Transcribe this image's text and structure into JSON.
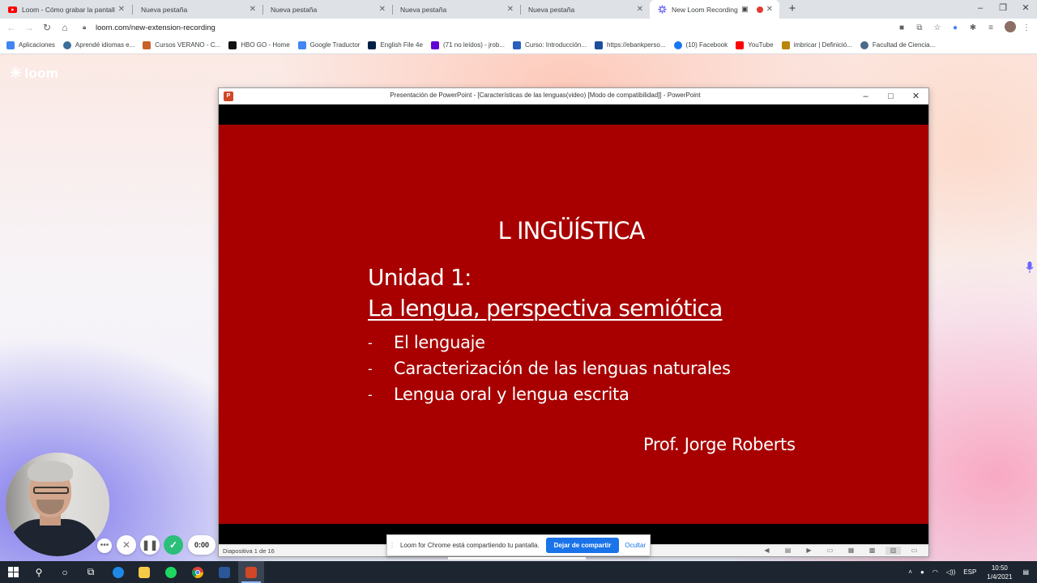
{
  "browser": {
    "tabs": [
      {
        "title": "Loom - Cómo grabar la pantalla",
        "favicon": "youtube-icon",
        "active": false
      },
      {
        "title": "Nueva pestaña",
        "favicon": "",
        "active": false
      },
      {
        "title": "Nueva pestaña",
        "favicon": "",
        "active": false
      },
      {
        "title": "Nueva pestaña",
        "favicon": "",
        "active": false
      },
      {
        "title": "Nueva pestaña",
        "favicon": "",
        "active": false
      },
      {
        "title": "New Loom Recording",
        "favicon": "loom-icon",
        "active": true
      }
    ],
    "new_tab_symbol": "+",
    "url": "loom.com/new-extension-recording",
    "bookmarks": [
      {
        "label": "Aplicaciones",
        "icon": "apps-grid-icon",
        "color": "#4285f4"
      },
      {
        "label": "Aprendé idiomas e...",
        "icon": "language-icon",
        "color": "#3c6e9c"
      },
      {
        "label": "Cursos VERANO - C...",
        "icon": "course-icon",
        "color": "#c8602a"
      },
      {
        "label": "HBO GO - Home",
        "icon": "hbo-icon",
        "color": "#111111"
      },
      {
        "label": "Google Traductor",
        "icon": "translate-icon",
        "color": "#4285f4"
      },
      {
        "label": "English File 4e",
        "icon": "oxford-icon",
        "color": "#002147"
      },
      {
        "label": "(71 no leídos) - jrob...",
        "icon": "yahoo-icon",
        "color": "#6001d2"
      },
      {
        "label": "Curso: Introducción...",
        "icon": "moodle-icon",
        "color": "#2a5fbf"
      },
      {
        "label": "https://ebankperso...",
        "icon": "bank-icon",
        "color": "#1d4f9c"
      },
      {
        "label": "(10) Facebook",
        "icon": "facebook-icon",
        "color": "#1877f2"
      },
      {
        "label": "YouTube",
        "icon": "youtube-icon",
        "color": "#ff0000"
      },
      {
        "label": "imbricar | Definició...",
        "icon": "dictionary-icon",
        "color": "#b8860b"
      },
      {
        "label": "Facultad de Ciencia...",
        "icon": "university-icon",
        "color": "#4b6a8a"
      }
    ]
  },
  "loom": {
    "logo_text": "loom",
    "timer": "0:00",
    "share_banner": {
      "message": "Loom for Chrome está compartiendo tu pantalla.",
      "stop_label": "Dejar de compartir",
      "hide_label": "Ocultar"
    }
  },
  "powerpoint": {
    "window_title": "Presentación de PowerPoint - [Características de las lenguas(video) [Modo de compatibilidad]] - PowerPoint",
    "slide": {
      "title": "L INGÜÍSTICA",
      "unit": "Unidad 1:",
      "subtitle": "La lengua, perspectiva semiótica",
      "bullets": [
        "El lenguaje",
        "Caracterización de las lenguas naturales",
        "Lengua oral y lengua escrita"
      ],
      "bullet_marker": "-",
      "author": "Prof. Jorge Roberts",
      "background_color": "#a80000"
    },
    "status": {
      "slide_counter": "Diapositiva 1 de 16"
    }
  },
  "taskbar": {
    "language": "ESP",
    "time": "10:50",
    "date": "1/4/2021"
  }
}
